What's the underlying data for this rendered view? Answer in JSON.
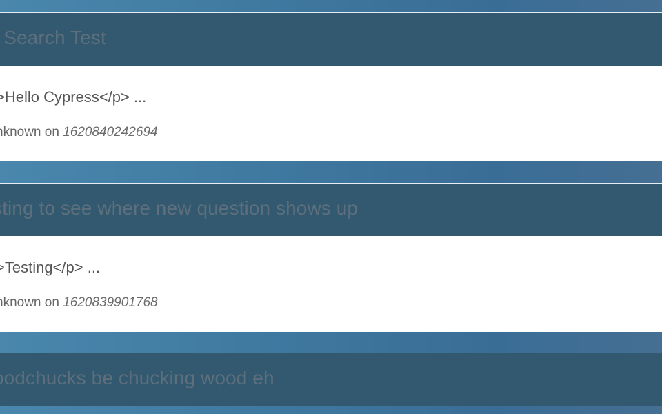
{
  "questions": [
    {
      "title": "r Search Test",
      "excerpt": ">Hello Cypress</p> ...",
      "author": "nknown",
      "on_word": " on ",
      "timestamp": "1620840242694"
    },
    {
      "title": "sting to see where new question shows up",
      "excerpt": ">Testing</p> ...",
      "author": "nknown",
      "on_word": " on ",
      "timestamp": "1620839901768"
    },
    {
      "title": "oodchucks be chucking wood eh"
    }
  ]
}
